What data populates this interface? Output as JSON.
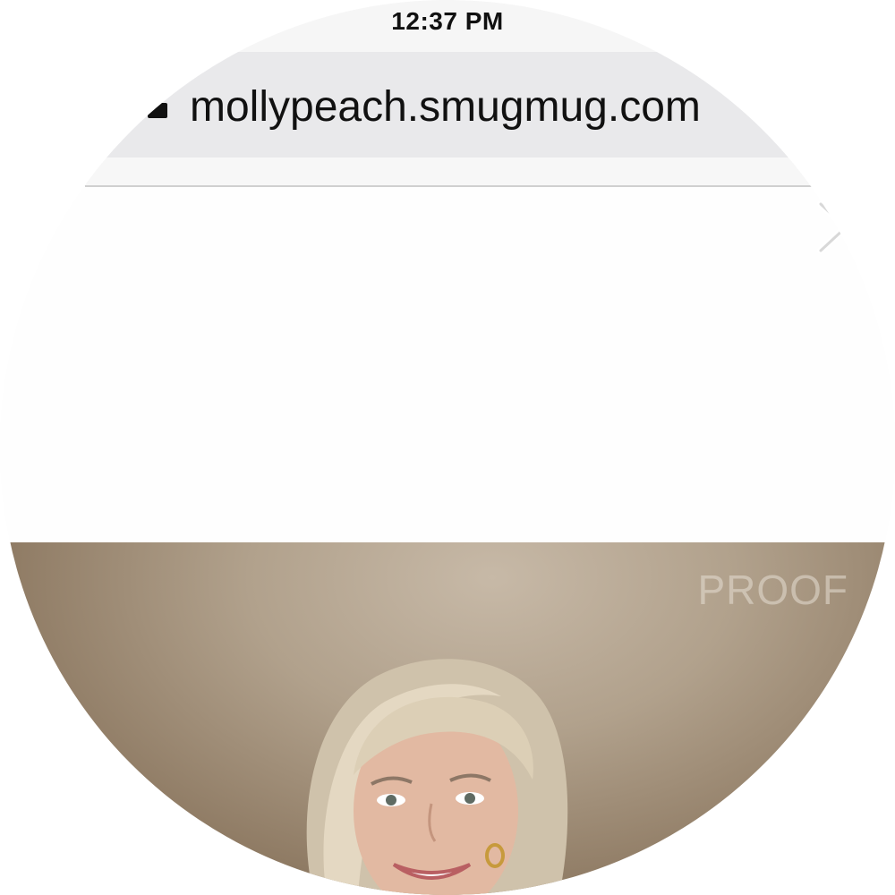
{
  "status_bar": {
    "time": "12:37 PM"
  },
  "browser": {
    "url": "mollypeach.smugmug.com",
    "lock_icon": "lock-icon"
  },
  "gallery": {
    "next_icon": "chevron-right-icon",
    "photo": {
      "watermark": "PROOF",
      "description_icon": "portrait-photo"
    }
  },
  "colors": {
    "status_bg": "#f6f6f6",
    "url_bar_bg": "#e9e9eb",
    "photo_backdrop": "#b1a18c",
    "watermark": "#e6ded4"
  }
}
